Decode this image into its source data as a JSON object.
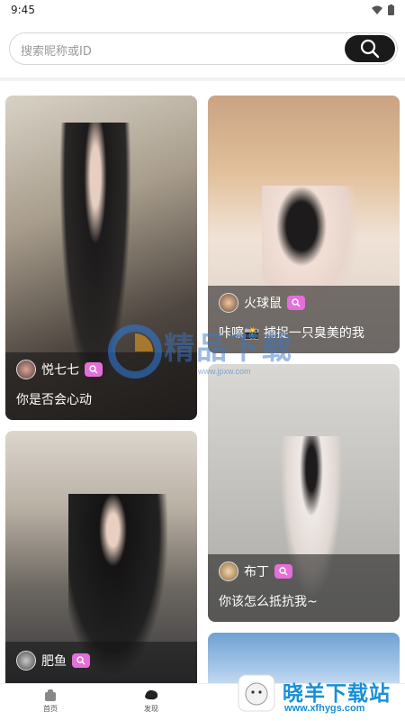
{
  "status": {
    "time": "9:45"
  },
  "search": {
    "placeholder": "搜索昵称或ID"
  },
  "cards": [
    {
      "name": "悦七七",
      "caption": "你是否会心动",
      "colors": [
        "#3d3631",
        "#7d6e5f",
        "#c9c2b5"
      ]
    },
    {
      "name": "火球鼠",
      "caption": "咔嚓📸 捕捉一只臭美的我",
      "colors": [
        "#b08a6e",
        "#d9b48f",
        "#eadbd0"
      ]
    },
    {
      "name": "布丁",
      "caption": "你该怎么抵抗我~",
      "colors": [
        "#b9b8b4",
        "#d6d5d0",
        "#9e9c98"
      ]
    },
    {
      "name": "肥鱼",
      "caption": "",
      "colors": [
        "#cfc8bf",
        "#8d857b",
        "#3a3a40"
      ]
    },
    {
      "name": "",
      "caption": "",
      "colors": [
        "#6fa1d4",
        "#a9c9ea",
        "#dde9f5"
      ]
    }
  ],
  "tabs": [
    {
      "label": "首页"
    },
    {
      "label": "发现"
    }
  ],
  "watermarks": {
    "center_text": "精品下载",
    "center_url": "www.jpxw.com",
    "bottom_text": "晓羊下载站",
    "bottom_url": "www.xfhygs.com"
  }
}
